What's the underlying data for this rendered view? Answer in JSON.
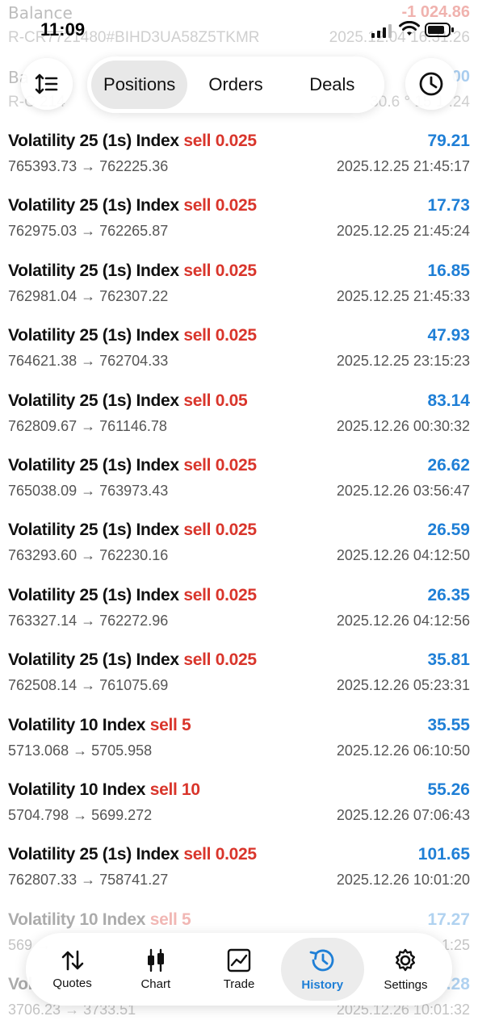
{
  "status_bar": {
    "time": "11:09"
  },
  "header_faded": {
    "balance_label": "Balance",
    "balance_value": "-1 024.86",
    "account_id": "R-CR7721480#BIHD3UA58Z5TKMR",
    "account_time": "2025.12.04 16:31:26",
    "row2_label": "Ba",
    "row2_value": "00",
    "row2_sub": "R-C    214",
    "row2_time": "30.6 ° 15 1  .24"
  },
  "toolbar": {
    "tabs": [
      "Positions",
      "Orders",
      "Deals"
    ],
    "active_tab": "Positions"
  },
  "deals": [
    {
      "symbol": "Volatility 25 (1s) Index",
      "side": "sell 0.025",
      "profit": "79.21",
      "open": "765393.73",
      "close": "762225.36",
      "time": "2025.12.25 21:45:17"
    },
    {
      "symbol": "Volatility 25 (1s) Index",
      "side": "sell 0.025",
      "profit": "17.73",
      "open": "762975.03",
      "close": "762265.87",
      "time": "2025.12.25 21:45:24"
    },
    {
      "symbol": "Volatility 25 (1s) Index",
      "side": "sell 0.025",
      "profit": "16.85",
      "open": "762981.04",
      "close": "762307.22",
      "time": "2025.12.25 21:45:33"
    },
    {
      "symbol": "Volatility 25 (1s) Index",
      "side": "sell 0.025",
      "profit": "47.93",
      "open": "764621.38",
      "close": "762704.33",
      "time": "2025.12.25 23:15:23"
    },
    {
      "symbol": "Volatility 25 (1s) Index",
      "side": "sell 0.05",
      "profit": "83.14",
      "open": "762809.67",
      "close": "761146.78",
      "time": "2025.12.26 00:30:32"
    },
    {
      "symbol": "Volatility 25 (1s) Index",
      "side": "sell 0.025",
      "profit": "26.62",
      "open": "765038.09",
      "close": "763973.43",
      "time": "2025.12.26 03:56:47"
    },
    {
      "symbol": "Volatility 25 (1s) Index",
      "side": "sell 0.025",
      "profit": "26.59",
      "open": "763293.60",
      "close": "762230.16",
      "time": "2025.12.26 04:12:50"
    },
    {
      "symbol": "Volatility 25 (1s) Index",
      "side": "sell 0.025",
      "profit": "26.35",
      "open": "763327.14",
      "close": "762272.96",
      "time": "2025.12.26 04:12:56"
    },
    {
      "symbol": "Volatility 25 (1s) Index",
      "side": "sell 0.025",
      "profit": "35.81",
      "open": "762508.14",
      "close": "761075.69",
      "time": "2025.12.26 05:23:31"
    },
    {
      "symbol": "Volatility 10 Index",
      "side": "sell 5",
      "profit": "35.55",
      "open": "5713.068",
      "close": "5705.958",
      "time": "2025.12.26 06:10:50"
    },
    {
      "symbol": "Volatility 10 Index",
      "side": "sell 10",
      "profit": "55.26",
      "open": "5704.798",
      "close": "5699.272",
      "time": "2025.12.26 07:06:43"
    },
    {
      "symbol": "Volatility 25 (1s) Index",
      "side": "sell 0.025",
      "profit": "101.65",
      "open": "762807.33",
      "close": "758741.27",
      "time": "2025.12.26 10:01:20"
    },
    {
      "symbol": "Volatility 10 Index",
      "side": "sell 5",
      "profit": "17.27",
      "open": "569",
      "close": "",
      "time": "1:25"
    },
    {
      "symbol": "Vol",
      "side": "",
      "profit": ".28",
      "open": "3706.23",
      "close": "3733.51",
      "time": "2025.12.26 10:01:32"
    }
  ],
  "arrow": "→",
  "tabbar": {
    "items": [
      {
        "label": "Quotes",
        "icon": "quotes-arrows-icon"
      },
      {
        "label": "Chart",
        "icon": "candlestick-icon"
      },
      {
        "label": "Trade",
        "icon": "trend-chart-icon"
      },
      {
        "label": "History",
        "icon": "history-clock-icon"
      },
      {
        "label": "Settings",
        "icon": "gear-icon"
      }
    ],
    "active": "History"
  },
  "colors": {
    "sell": "#d9352b",
    "profit": "#1f7fd6",
    "active_tab": "#1f7fd6"
  }
}
